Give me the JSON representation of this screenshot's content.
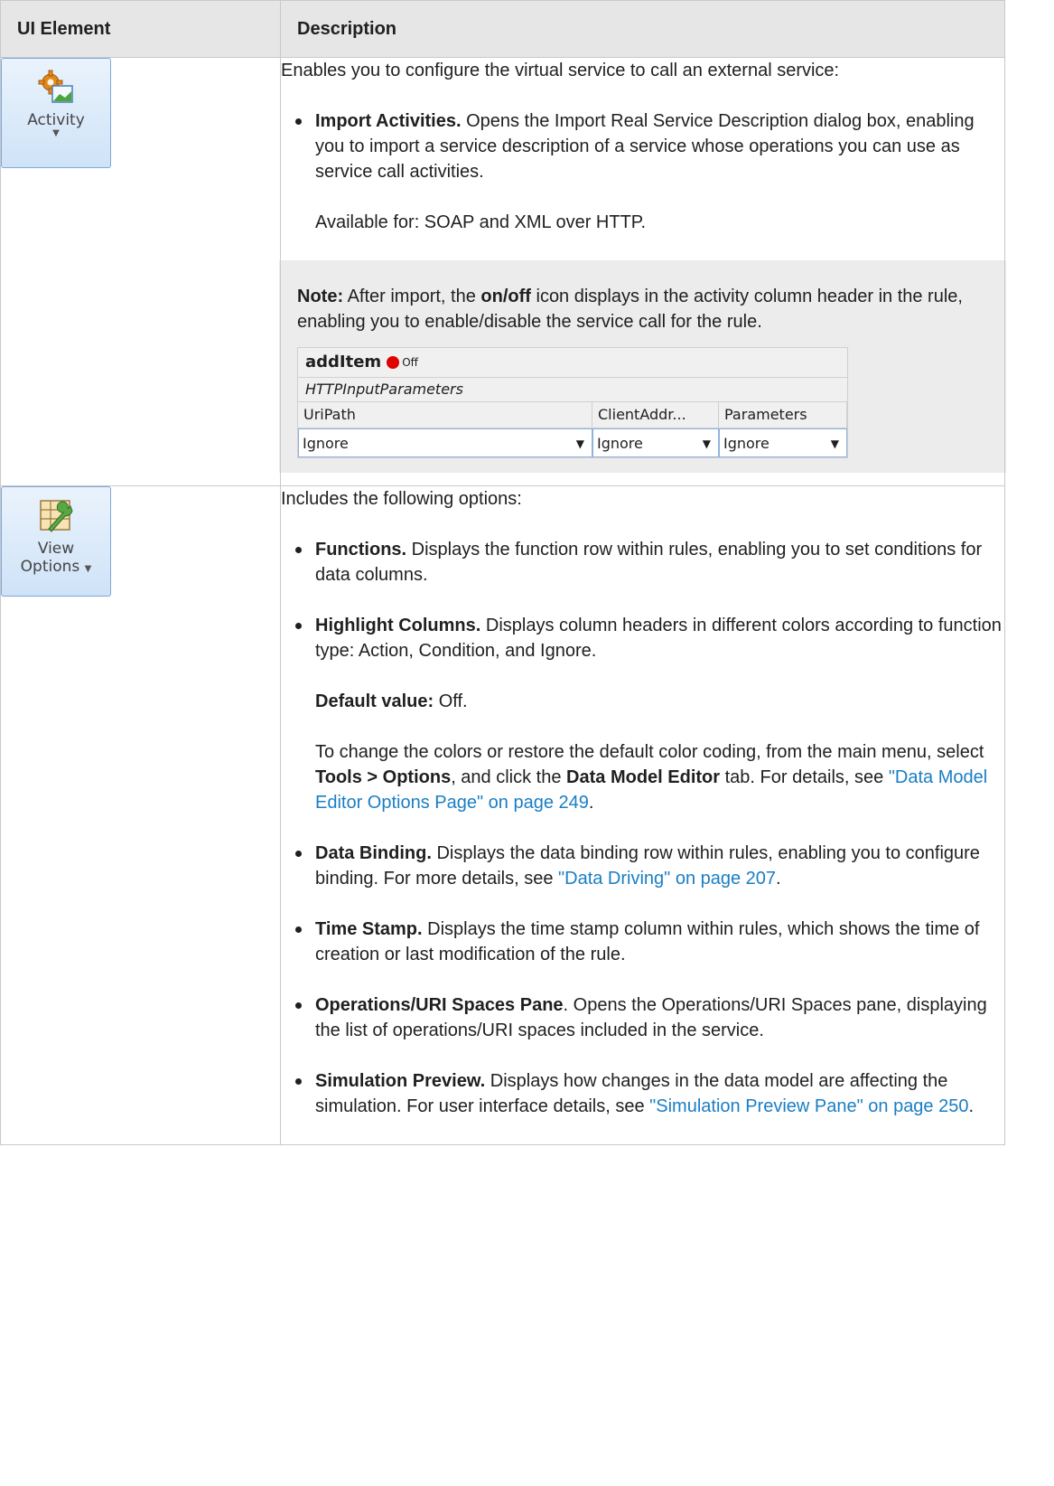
{
  "table": {
    "headers": [
      "UI Element",
      "Description"
    ]
  },
  "row1": {
    "button": {
      "label": "Activity",
      "icon": "gear-image-icon"
    },
    "intro": "Enables you to configure the virtual service to call an external service:",
    "bullet1": {
      "title": "Import Activities.",
      "text": " Opens the Import Real Service Description dialog box, enabling you to import a service description of a service whose operations you can use as service call activities."
    },
    "available": "Available for: SOAP and XML over HTTP.",
    "note": {
      "label": "Note:",
      "text_a": " After import, the ",
      "onoff": "on/off",
      "text_b": " icon displays in the activity column header in the rule, enabling you to enable/disable the service call for the rule."
    },
    "grid": {
      "title": "addItem",
      "status": "Off",
      "subtitle": "HTTPInputParameters",
      "columns": [
        "UriPath",
        "ClientAddr...",
        "Parameters"
      ],
      "values": [
        "Ignore",
        "Ignore",
        "Ignore"
      ]
    }
  },
  "row2": {
    "button": {
      "label_line1": "View",
      "label_line2": "Options",
      "icon": "view-options-wrench-icon"
    },
    "intro": "Includes the following options:",
    "functions": {
      "title": "Functions.",
      "text": " Displays the function row within rules, enabling you to set conditions for data columns."
    },
    "highlight": {
      "title": "Highlight Columns.",
      "text": " Displays column headers in different colors according to function type: Action, Condition, and Ignore."
    },
    "default_label": "Default value:",
    "default_value": " Off.",
    "colors_a": "To change the colors or restore the default color coding, from the main menu, select ",
    "colors_menu": "Tools > Options",
    "colors_b": ", and click the ",
    "colors_tab": "Data Model Editor",
    "colors_c": " tab. For details, see ",
    "colors_link": "\"Data Model Editor Options Page\" on page 249",
    "colors_end": ".",
    "binding": {
      "title": "Data Binding.",
      "text": " Displays the data binding row within rules, enabling you to configure binding. For more details, see ",
      "link": "\"Data Driving\" on page 207",
      "end": "."
    },
    "timestamp": {
      "title": "Time Stamp.",
      "text": " Displays the time stamp column within rules, which shows the time of creation or last modification of the rule."
    },
    "operations": {
      "title": "Operations/URI Spaces Pane",
      "text": ". Opens the Operations/URI Spaces pane, displaying the list of operations/URI spaces included in the service."
    },
    "simulation": {
      "title": "Simulation Preview.",
      "text": " Displays how changes in the data model are affecting the simulation. For user interface details, see ",
      "link": "\"Simulation Preview Pane\" on page 250",
      "end": "."
    }
  },
  "colors": {
    "link": "#1a7ec4",
    "header_bg": "#e6e6e6",
    "note_bg": "#ececec",
    "status_dot": "#e00000"
  }
}
